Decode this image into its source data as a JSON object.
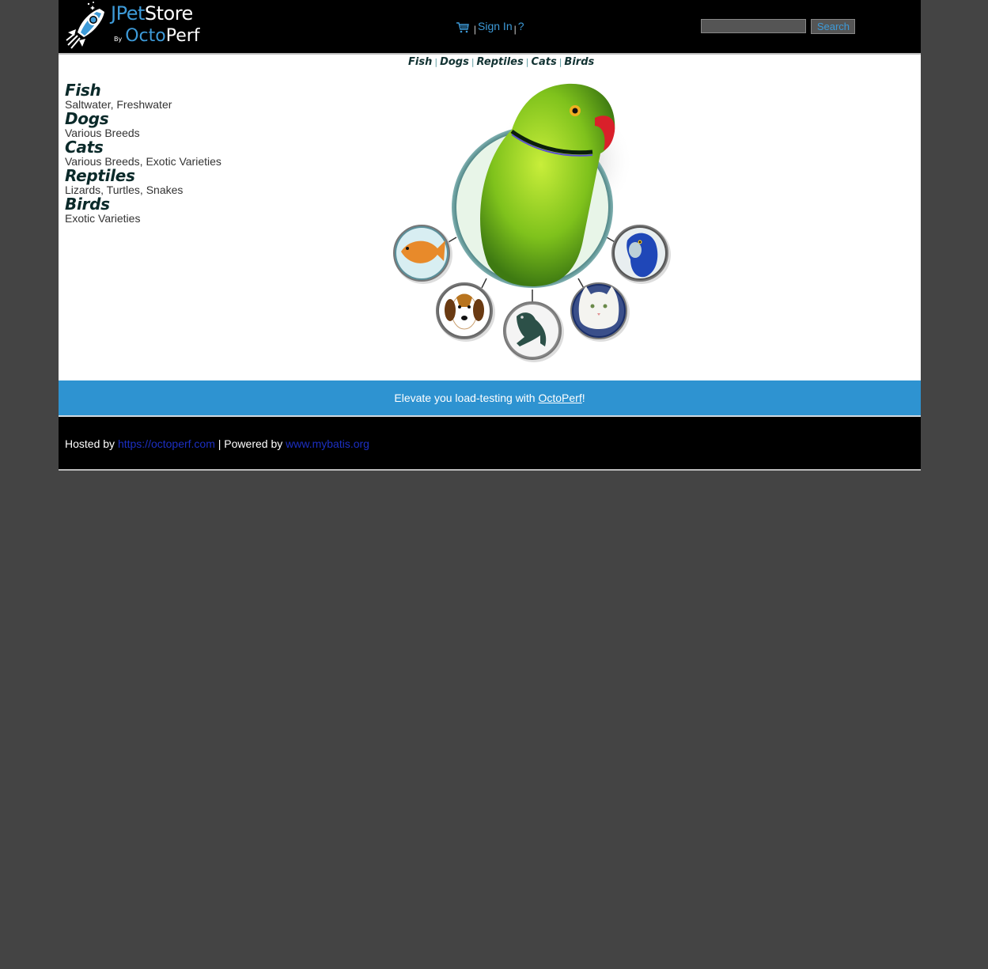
{
  "header": {
    "logo": {
      "jpet": "JPet",
      "store": "Store",
      "by": "By",
      "octo": "Octo",
      "perf": "Perf"
    },
    "menu": {
      "cart_icon": "shopping-cart-icon",
      "separator": "|",
      "sign_in": "Sign In",
      "help": "?"
    },
    "search": {
      "value": "",
      "button_label": "Search"
    }
  },
  "quicklinks": [
    {
      "label": "Fish"
    },
    {
      "label": "Dogs"
    },
    {
      "label": "Reptiles"
    },
    {
      "label": "Cats"
    },
    {
      "label": "Birds"
    }
  ],
  "sidebar": {
    "categories": [
      {
        "name": "Fish",
        "description": "Saltwater, Freshwater"
      },
      {
        "name": "Dogs",
        "description": "Various Breeds"
      },
      {
        "name": "Cats",
        "description": "Various Breeds, Exotic Varieties"
      },
      {
        "name": "Reptiles",
        "description": "Lizards, Turtles, Snakes"
      },
      {
        "name": "Birds",
        "description": "Exotic Varieties"
      }
    ]
  },
  "banner": {
    "text_before": "Elevate you load-testing with ",
    "link": "OctoPerf",
    "text_after": "!"
  },
  "footer": {
    "hosted_by": "Hosted by ",
    "hosted_link": "https://octoperf.com",
    "powered_by": " | Powered by ",
    "powered_link": "www.mybatis.org"
  },
  "colors": {
    "page_bg": "#444444",
    "header_bg": "#000000",
    "accent_blue": "#3d9ad8",
    "banner_bg": "#2e93d1",
    "footer_link": "#1c2fc2"
  }
}
